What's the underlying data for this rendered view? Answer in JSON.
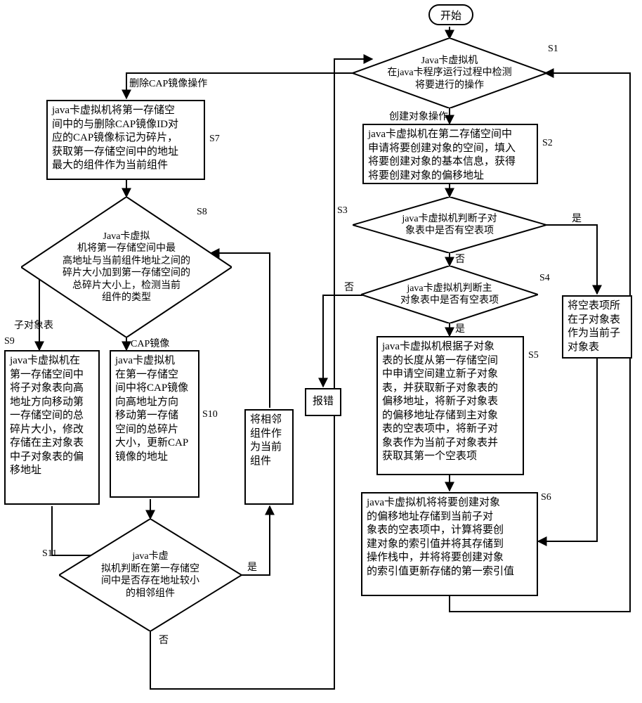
{
  "start": "开始",
  "s1": "Java卡虚拟机\n在java卡程序运行过程中检测\n将要进行的操作",
  "s1_lbl": "S1",
  "branch_create": "创建对象操作",
  "branch_delete": "删除CAP镜像操作",
  "s2": "java卡虚拟机在第二存储空间中\n申请将要创建对象的空间，填入\n将要创建对象的基本信息，获得\n将要创建对象的偏移地址",
  "s2_lbl": "S2",
  "s3": "java卡虚拟机判断子对\n象表中是否有空表项",
  "s3_lbl": "S3",
  "yes": "是",
  "no": "否",
  "s4": "java卡虚拟机判断主\n对象表中是否有空表项",
  "s4_lbl": "S4",
  "s5": "java卡虚拟机根据子对象\n表的长度从第一存储空间\n中申请空间建立新子对象\n表，并获取新子对象表的\n偏移地址，将新子对象表\n的偏移地址存储到主对象\n表的空表项中，将新子对\n象表作为当前子对象表并\n获取其第一个空表项",
  "s5_lbl": "S5",
  "side_box": "将空表项所\n在子对象表\n作为当前子\n对象表",
  "s6": "java卡虚拟机将将要创建对象\n的偏移地址存储到当前子对\n象表的空表项中，计算将要创\n建对象的索引值并将其存储到\n操作栈中，并将将要创建对象\n的索引值更新存储的第一索引值",
  "s6_lbl": "S6",
  "error": "报错",
  "s7": "java卡虚拟机将第一存储空\n间中的与删除CAP镜像ID对\n应的CAP镜像标记为碎片，\n获取第一存储空间中的地址\n最大的组件作为当前组件",
  "s7_lbl": "S7",
  "s8": "Java卡虚拟\n机将第一存储空间中最\n高地址与当前组件地址之间的\n碎片大小加到第一存储空间的\n总碎片大小上，检测当前\n组件的类型",
  "s8_lbl": "S8",
  "sub_table": "子对象表",
  "cap_mirror": "CAP镜像",
  "s9": "java卡虚拟机在\n第一存储空间中\n将子对象表向高\n地址方向移动第\n一存储空间的总\n碎片大小，修改\n存储在主对象表\n中子对象表的偏\n移地址",
  "s9_lbl": "S9",
  "s10": "java卡虚拟机\n在第一存储空\n间中将CAP镜像\n向高地址方向\n移动第一存储\n空间的总碎片\n大小，更新CAP\n镜像的地址",
  "s10_lbl": "S10",
  "adj": "将相邻\n组件作\n为当前\n组件",
  "s11": "java卡虚\n拟机判断在第一存储空\n间中是否存在地址较小\n的相邻组件",
  "s11_lbl": "S11",
  "chart_data": {
    "type": "flowchart",
    "nodes": [
      {
        "id": "start",
        "kind": "terminator",
        "text": "开始"
      },
      {
        "id": "S1",
        "kind": "decision",
        "text": "Java卡虚拟机在java卡程序运行过程中检测将要进行的操作"
      },
      {
        "id": "S2",
        "kind": "process",
        "text": "java卡虚拟机在第二存储空间中申请将要创建对象的空间，填入将要创建对象的基本信息，获得将要创建对象的偏移地址"
      },
      {
        "id": "S3",
        "kind": "decision",
        "text": "java卡虚拟机判断子对象表中是否有空表项"
      },
      {
        "id": "S4",
        "kind": "decision",
        "text": "java卡虚拟机判断主对象表中是否有空表项"
      },
      {
        "id": "S5",
        "kind": "process",
        "text": "java卡虚拟机根据子对象表的长度从第一存储空间中申请空间建立新子对象表，并获取新子对象表的偏移地址，将新子对象表的偏移地址存储到主对象表的空表项中，将新子对象表作为当前子对象表并获取其第一个空表项"
      },
      {
        "id": "sidebox",
        "kind": "process",
        "text": "将空表项所在子对象表作为当前子对象表"
      },
      {
        "id": "S6",
        "kind": "process",
        "text": "java卡虚拟机将将要创建对象的偏移地址存储到当前子对象表的空表项中，计算将要创建对象的索引值并将其存储到操作栈中，并将将要创建对象的索引值更新存储的第一索引值"
      },
      {
        "id": "error",
        "kind": "process",
        "text": "报错"
      },
      {
        "id": "S7",
        "kind": "process",
        "text": "java卡虚拟机将第一存储空间中的与删除CAP镜像ID对应的CAP镜像标记为碎片，获取第一存储空间中的地址最大的组件作为当前组件"
      },
      {
        "id": "S8",
        "kind": "decision",
        "text": "Java卡虚拟机将第一存储空间中最高地址与当前组件地址之间的碎片大小加到第一存储空间的总碎片大小上，检测当前组件的类型"
      },
      {
        "id": "S9",
        "kind": "process",
        "text": "java卡虚拟机在第一存储空间中将子对象表向高地址方向移动第一存储空间的总碎片大小，修改存储在主对象表中子对象表的偏移地址"
      },
      {
        "id": "S10",
        "kind": "process",
        "text": "java卡虚拟机在第一存储空间中将CAP镜像向高地址方向移动第一存储空间的总碎片大小，更新CAP镜像的地址"
      },
      {
        "id": "adj",
        "kind": "process",
        "text": "将相邻组件作为当前组件"
      },
      {
        "id": "S11",
        "kind": "decision",
        "text": "java卡虚拟机判断在第一存储空间中是否存在地址较小的相邻组件"
      }
    ],
    "edges": [
      {
        "from": "start",
        "to": "S1"
      },
      {
        "from": "S1",
        "to": "S2",
        "label": "创建对象操作"
      },
      {
        "from": "S1",
        "to": "S7",
        "label": "删除CAP镜像操作"
      },
      {
        "from": "S2",
        "to": "S3"
      },
      {
        "from": "S3",
        "to": "sidebox",
        "label": "是"
      },
      {
        "from": "S3",
        "to": "S4",
        "label": "否"
      },
      {
        "from": "S4",
        "to": "S5",
        "label": "是"
      },
      {
        "from": "S4",
        "to": "error",
        "label": "否"
      },
      {
        "from": "sidebox",
        "to": "S6"
      },
      {
        "from": "S5",
        "to": "S6"
      },
      {
        "from": "S7",
        "to": "S8"
      },
      {
        "from": "S8",
        "to": "S9",
        "label": "子对象表"
      },
      {
        "from": "S8",
        "to": "S10",
        "label": "CAP镜像"
      },
      {
        "from": "S9",
        "to": "S11"
      },
      {
        "from": "S10",
        "to": "S11"
      },
      {
        "from": "S11",
        "to": "adj",
        "label": "是"
      },
      {
        "from": "adj",
        "to": "S8"
      },
      {
        "from": "S11",
        "to": "S1",
        "label": "否"
      },
      {
        "from": "S6",
        "to": "S1"
      }
    ]
  }
}
